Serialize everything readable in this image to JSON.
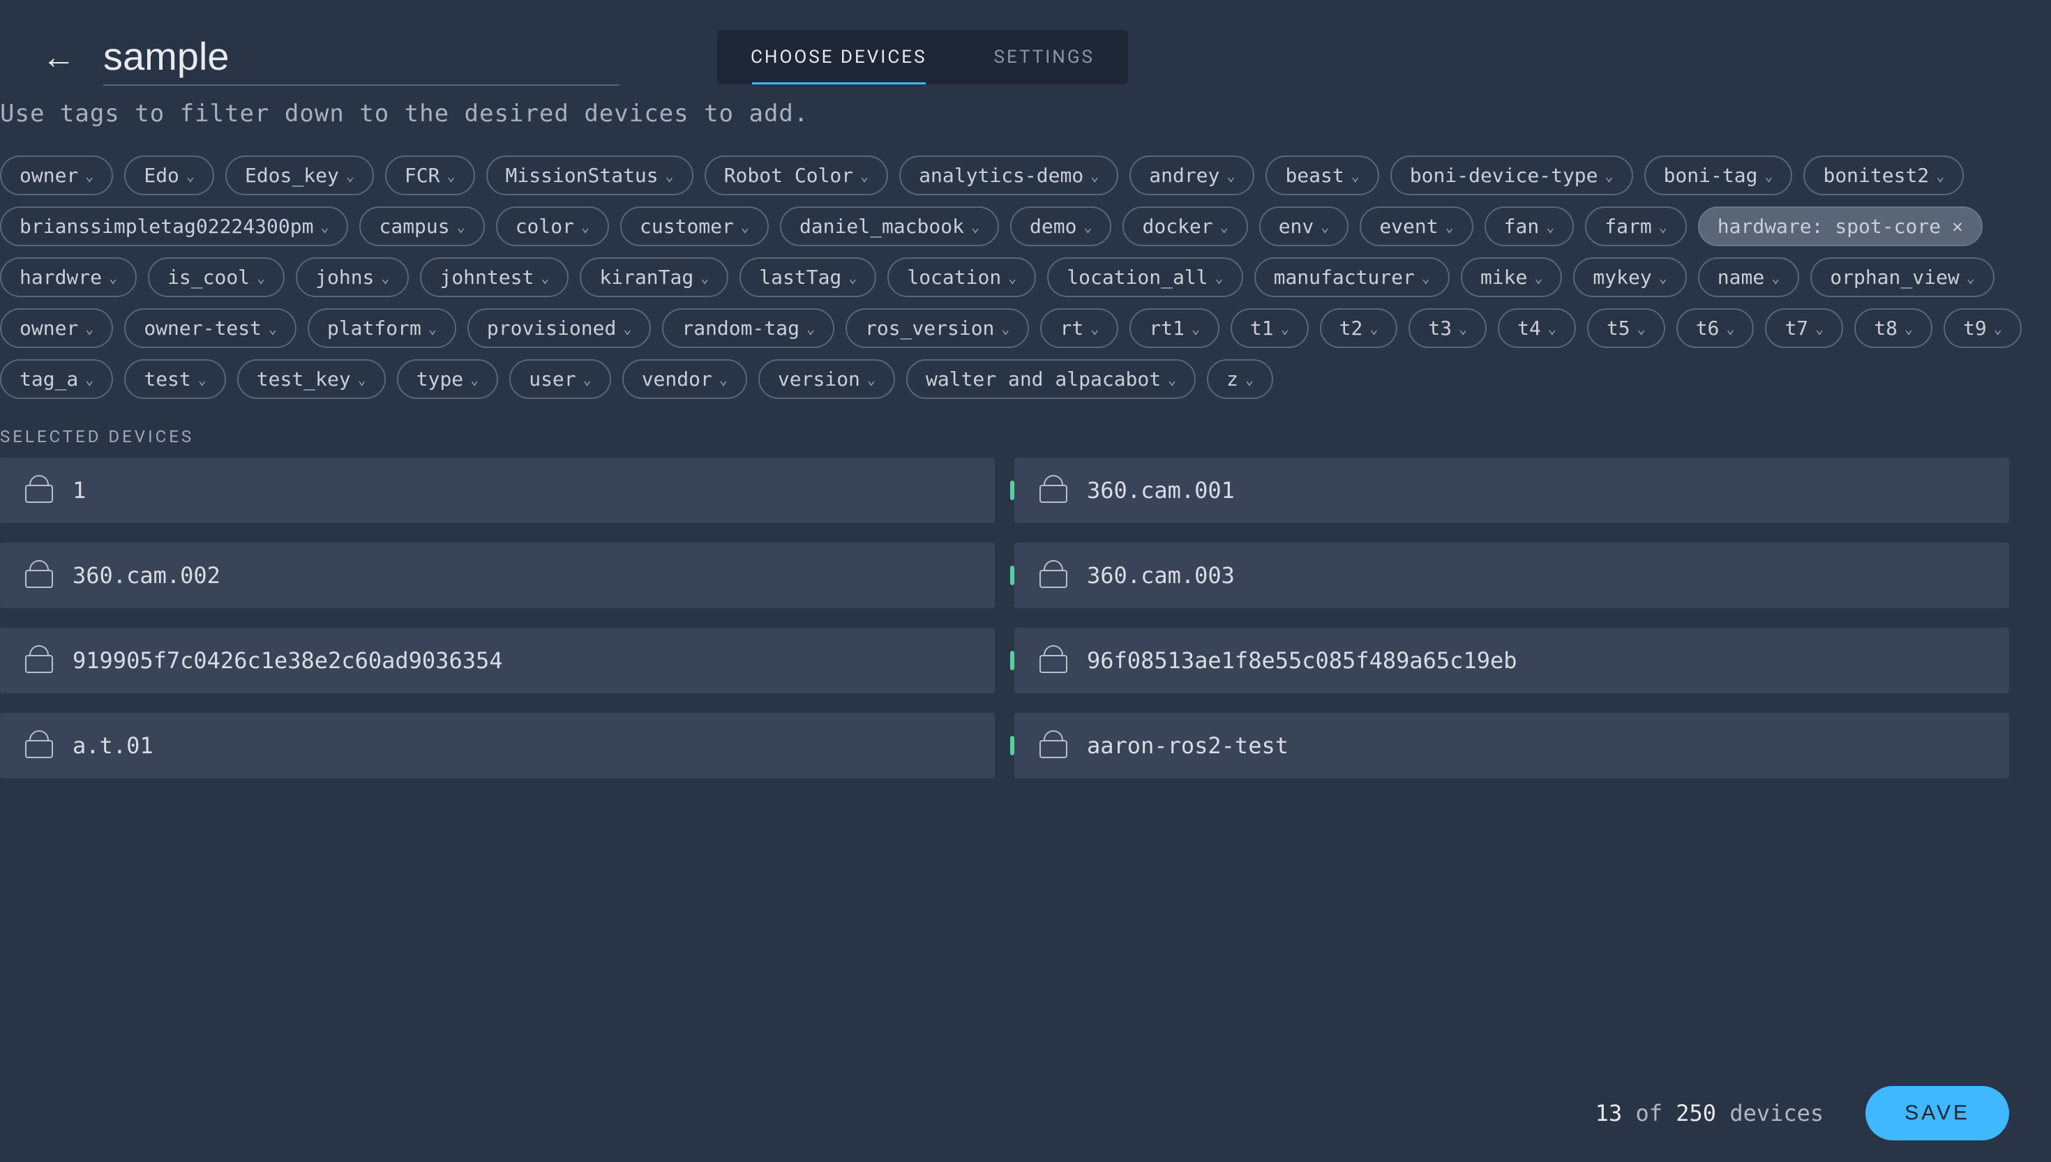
{
  "header": {
    "title_value": "sample",
    "tabs": [
      {
        "label": "CHOOSE DEVICES",
        "active": true
      },
      {
        "label": "SETTINGS",
        "active": false
      }
    ]
  },
  "hint": "Use tags to filter down to the desired devices to add.",
  "tags": [
    {
      "label": "owner"
    },
    {
      "label": "Edo"
    },
    {
      "label": "Edos_key"
    },
    {
      "label": "FCR"
    },
    {
      "label": "MissionStatus"
    },
    {
      "label": "Robot Color"
    },
    {
      "label": "analytics-demo"
    },
    {
      "label": "andrey"
    },
    {
      "label": "beast"
    },
    {
      "label": "boni-device-type"
    },
    {
      "label": "boni-tag"
    },
    {
      "label": "bonitest2"
    },
    {
      "label": "brianssimpletag02224300pm"
    },
    {
      "label": "campus"
    },
    {
      "label": "color"
    },
    {
      "label": "customer"
    },
    {
      "label": "daniel_macbook"
    },
    {
      "label": "demo"
    },
    {
      "label": "docker"
    },
    {
      "label": "env"
    },
    {
      "label": "event"
    },
    {
      "label": "fan"
    },
    {
      "label": "farm"
    },
    {
      "label": "hardware: spot-core",
      "selected": true
    },
    {
      "label": "hardwre"
    },
    {
      "label": "is_cool"
    },
    {
      "label": "johns"
    },
    {
      "label": "johntest"
    },
    {
      "label": "kiranTag"
    },
    {
      "label": "lastTag"
    },
    {
      "label": "location"
    },
    {
      "label": "location_all"
    },
    {
      "label": "manufacturer"
    },
    {
      "label": "mike"
    },
    {
      "label": "mykey"
    },
    {
      "label": "name"
    },
    {
      "label": "orphan_view"
    },
    {
      "label": "owner"
    },
    {
      "label": "owner-test"
    },
    {
      "label": "platform"
    },
    {
      "label": "provisioned"
    },
    {
      "label": "random-tag"
    },
    {
      "label": "ros_version"
    },
    {
      "label": "rt"
    },
    {
      "label": "rt1"
    },
    {
      "label": "t1"
    },
    {
      "label": "t2"
    },
    {
      "label": "t3"
    },
    {
      "label": "t4"
    },
    {
      "label": "t5"
    },
    {
      "label": "t6"
    },
    {
      "label": "t7"
    },
    {
      "label": "t8"
    },
    {
      "label": "t9"
    },
    {
      "label": "tag_a"
    },
    {
      "label": "test"
    },
    {
      "label": "test_key"
    },
    {
      "label": "type"
    },
    {
      "label": "user"
    },
    {
      "label": "vendor"
    },
    {
      "label": "version"
    },
    {
      "label": "walter and alpacabot"
    },
    {
      "label": "z"
    }
  ],
  "section_label": "SELECTED DEVICES",
  "devices": [
    {
      "name": "1"
    },
    {
      "name": "360.cam.001"
    },
    {
      "name": "360.cam.002"
    },
    {
      "name": "360.cam.003"
    },
    {
      "name": "919905f7c0426c1e38e2c60ad9036354"
    },
    {
      "name": "96f08513ae1f8e55c085f489a65c19eb"
    },
    {
      "name": "a.t.01"
    },
    {
      "name": "aaron-ros2-test"
    }
  ],
  "footer": {
    "count_selected": "13",
    "count_word_of": "of",
    "count_total": "250",
    "count_unit": "devices",
    "save_label": "SAVE"
  }
}
